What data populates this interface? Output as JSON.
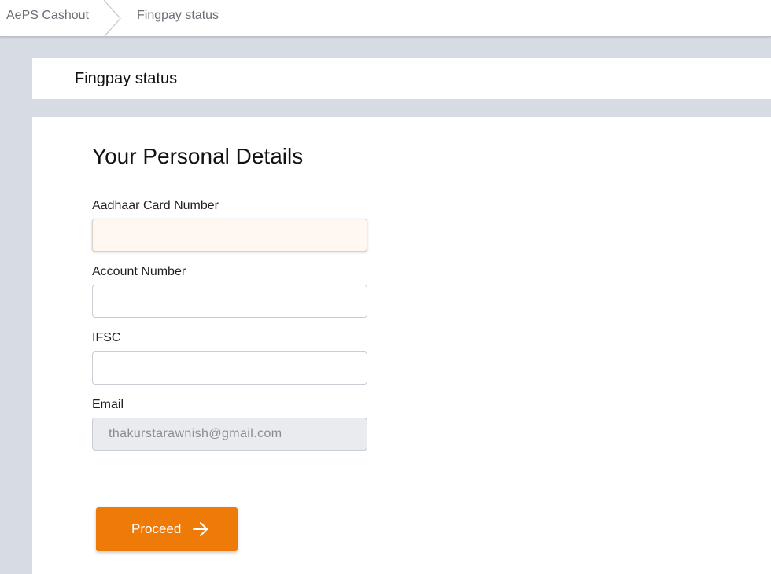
{
  "breadcrumb": {
    "items": [
      {
        "label": "AePS Cashout"
      },
      {
        "label": "Fingpay status"
      }
    ],
    "separator_icon": "chevron-right-icon"
  },
  "page": {
    "title": "Fingpay status"
  },
  "form": {
    "section_title": "Your Personal Details",
    "fields": {
      "aadhaar": {
        "label": "Aadhaar Card Number",
        "value": "",
        "placeholder": ""
      },
      "account": {
        "label": "Account Number",
        "value": "",
        "placeholder": ""
      },
      "ifsc": {
        "label": "IFSC",
        "value": "",
        "placeholder": ""
      },
      "email": {
        "label": "Email",
        "value": "thakurstarawnish@gmail.com",
        "readonly": true
      }
    },
    "submit": {
      "label": "Proceed",
      "icon": "arrow-right-icon",
      "color": "#ee7a07"
    }
  }
}
